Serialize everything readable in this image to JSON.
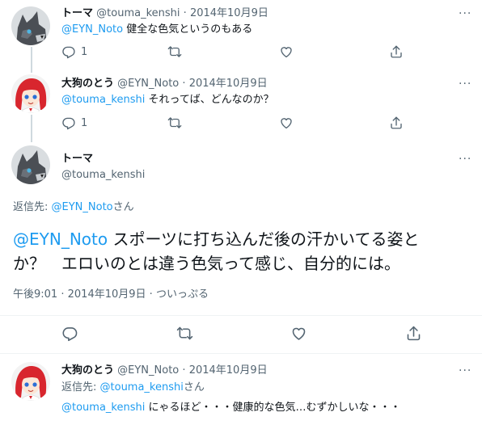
{
  "tweets": [
    {
      "display_name": "トーマ",
      "handle": "@touma_kenshi",
      "separator": "·",
      "date": "2014年10月9日",
      "mention": "@EYN_Noto",
      "text": " 健全な色気というのもある",
      "reply_count": "1",
      "avatar": "gray-wolf-avatar"
    },
    {
      "display_name": "大狗のとう",
      "handle": "@EYN_Noto",
      "separator": "·",
      "date": "2014年10月9日",
      "mention": "@touma_kenshi",
      "text": " それってば、どんなのか？",
      "reply_count": "1",
      "avatar": "red-hair-girl-avatar"
    }
  ],
  "focus": {
    "display_name": "トーマ",
    "handle": "@touma_kenshi",
    "replying_to_label": "返信先: ",
    "replying_to_handle": "@EYN_Noto",
    "replying_to_suffix": "さん",
    "mention": "@EYN_Noto",
    "text_line1": " スポーツに打ち込んだ後の汗かいてる姿と",
    "text_line2": "か？　エロいのとは違う色気って感じ、自分的には。",
    "time": "午後9:01",
    "separator1": "·",
    "date": "2014年10月9日",
    "separator2": "·",
    "client": "ついっぷる"
  },
  "reply": {
    "display_name": "大狗のとう",
    "handle": "@EYN_Noto",
    "separator": "·",
    "date": "2014年10月9日",
    "replying_to_label": "返信先: ",
    "replying_to_handle": "@touma_kenshi",
    "replying_to_suffix": "さん",
    "mention": "@touma_kenshi",
    "text": " にゃるほど・・・健康的な色気…むずかしいな・・・"
  },
  "more_label": "···",
  "colors": {
    "link": "#1d9bf0",
    "muted": "#536471",
    "text": "#0f1419",
    "divider": "#eff3f4"
  },
  "icons": [
    "reply-icon",
    "retweet-icon",
    "like-icon",
    "share-icon",
    "more-icon"
  ]
}
